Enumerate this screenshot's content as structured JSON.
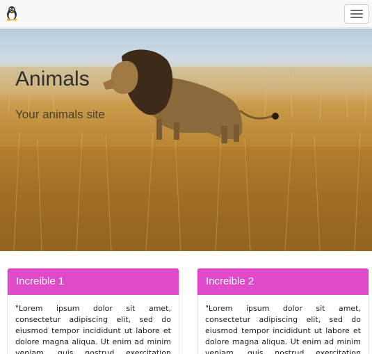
{
  "navbar": {
    "brand_icon": "linux-penguin-icon",
    "toggle_icon": "hamburger-menu-icon"
  },
  "hero": {
    "title": "Animals",
    "subtitle": "Your animals site",
    "image_subject": "lion in tall grass"
  },
  "cards": [
    {
      "title": "Increible 1",
      "text": "\"Lorem ipsum dolor sit amet, consectetur adipiscing elit, sed do eiusmod tempor incididunt ut labore et dolore magna aliqua. Ut enim ad minim veniam, quis nostrud exercitation ullamco laboris nisi ut aliquip ex"
    },
    {
      "title": "Increible 2",
      "text": "\"Lorem ipsum dolor sit amet, consectetur adipiscing elit, sed do eiusmod tempor incididunt ut labore et dolore magna aliqua. Ut enim ad minim veniam, quis nostrud exercitation ullamco laboris nisi ut aliquip ex"
    }
  ],
  "colors": {
    "card_header": "#e14acb",
    "navbar_bg": "#f8f8f8"
  }
}
